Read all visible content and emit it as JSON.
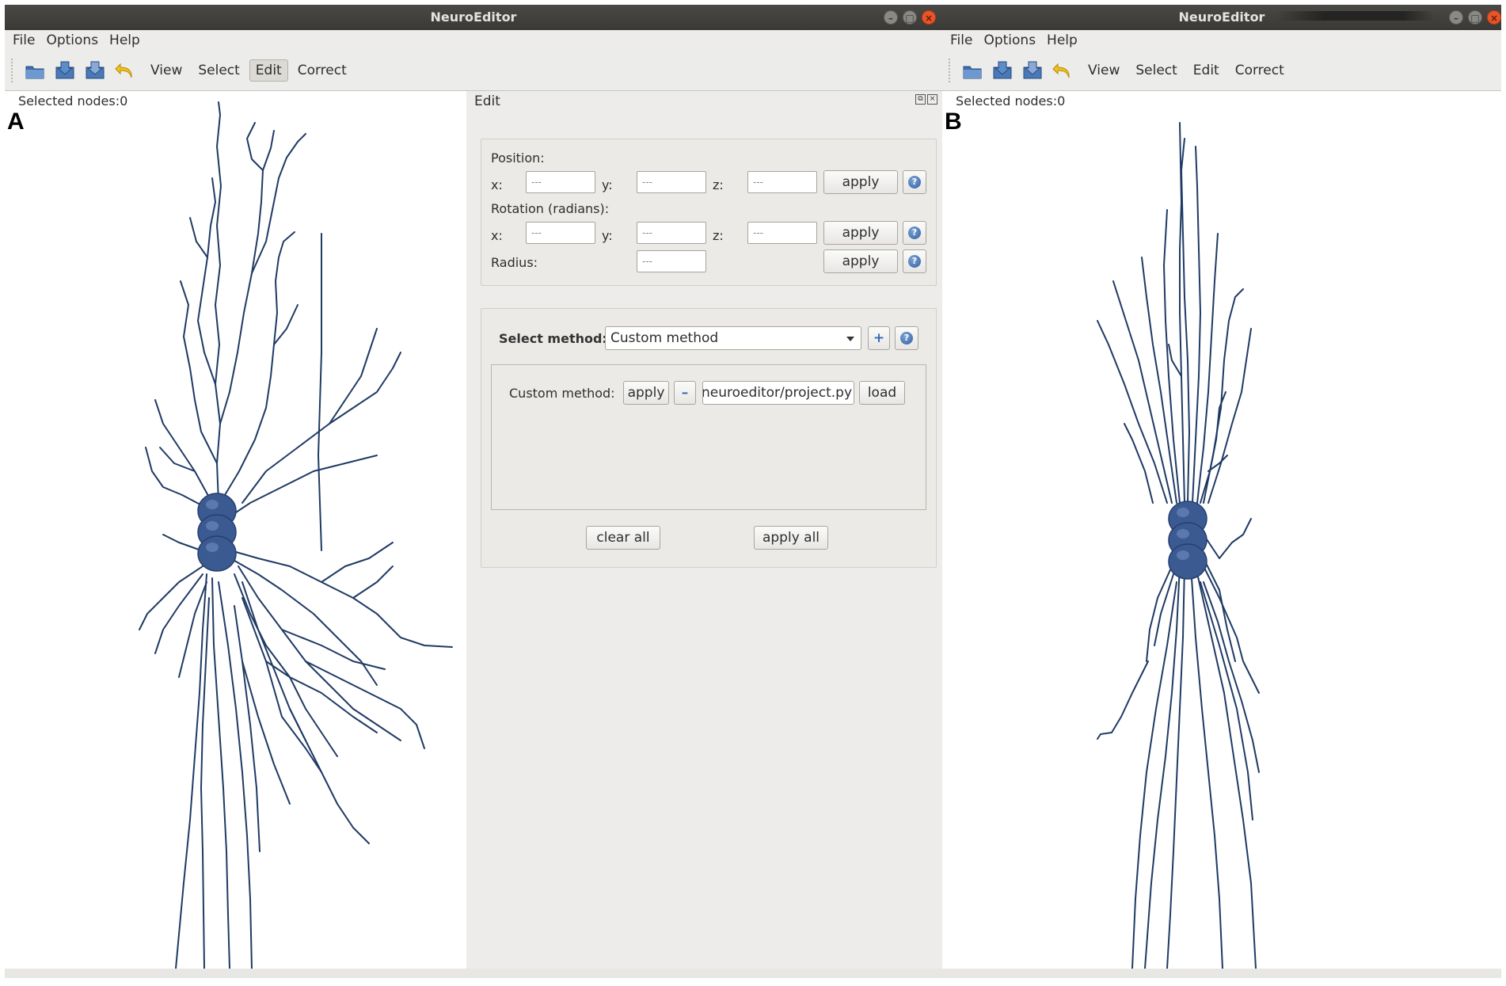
{
  "windows": [
    {
      "title": "NeuroEditor",
      "menu": [
        "File",
        "Options",
        "Help"
      ],
      "toolbar": {
        "icons": [
          "open-icon",
          "save-icon",
          "save-as-icon",
          "undo-icon"
        ],
        "tabs": [
          "View",
          "Select",
          "Edit",
          "Correct"
        ],
        "active_tab": "Edit"
      },
      "selected_nodes": "Selected nodes:0",
      "panel_label": "A"
    },
    {
      "title": "NeuroEditor",
      "menu": [
        "File",
        "Options",
        "Help"
      ],
      "toolbar": {
        "icons": [
          "open-icon",
          "save-icon",
          "save-as-icon",
          "undo-icon"
        ],
        "tabs": [
          "View",
          "Select",
          "Edit",
          "Correct"
        ]
      },
      "selected_nodes": "Selected nodes:0",
      "panel_label": "B"
    }
  ],
  "edit_panel": {
    "title": "Edit",
    "position": {
      "label": "Position:",
      "x_label": "x:",
      "y_label": "y:",
      "z_label": "z:",
      "x": "---",
      "y": "---",
      "z": "---",
      "apply": "apply"
    },
    "rotation": {
      "label": "Rotation (radians):",
      "x_label": "x:",
      "y_label": "y:",
      "z_label": "z:",
      "x": "---",
      "y": "---",
      "z": "---",
      "apply": "apply"
    },
    "radius": {
      "label": "Radius:",
      "value": "---",
      "apply": "apply"
    },
    "select_method": {
      "label": "Select method:",
      "value": "Custom method"
    },
    "custom_method": {
      "label": "Custom method:",
      "apply": "apply",
      "remove": "–",
      "path": "/neuroeditor/project.py",
      "load": "load"
    },
    "clear_all": "clear all",
    "apply_all": "apply all"
  },
  "colors": {
    "neuron": "#1f3a64",
    "soma": "#3c5a92",
    "titlebar": "#3e3d39",
    "close": "#e9552a"
  }
}
